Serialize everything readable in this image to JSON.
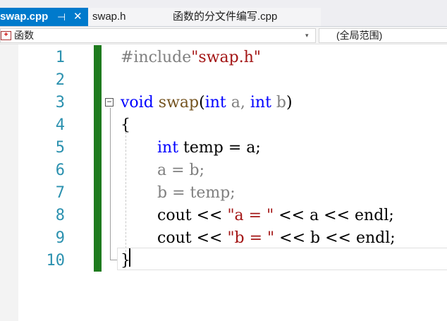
{
  "tabs": [
    {
      "label": "swap.cpp",
      "pin_glyph": "⊣",
      "close_glyph": "✕"
    },
    {
      "label": "swap.h"
    },
    {
      "label": "函数的分文件编写.cpp"
    }
  ],
  "navbar": {
    "scope_icon": "class-scope-icon",
    "scope_label": "函数",
    "scope_arrow": "▾",
    "member_label": "(全局范围)"
  },
  "editor": {
    "line_numbers": [
      "1",
      "2",
      "3",
      "4",
      "5",
      "6",
      "7",
      "8",
      "9",
      "10"
    ],
    "collapse_glyph": "−",
    "colors": {
      "keyword": "#0000ff",
      "string": "#a31515",
      "line_number": "#2b91af",
      "change_bar": "#1e7b1e",
      "tab_active_bg": "#007acc"
    },
    "code": {
      "l1": {
        "directive": "#include",
        "header": "\"swap.h\""
      },
      "l3": {
        "kw_void": "void",
        "fn": "swap",
        "open": "(",
        "kw_int1": "int",
        "param1": "a,",
        "kw_int2": "int",
        "param2": "b",
        "close": ")"
      },
      "l4": {
        "brace": "{"
      },
      "l5": {
        "kw_int": "int",
        "rest": "temp = a;"
      },
      "l6": {
        "text": "a = b;"
      },
      "l7": {
        "text": "b = temp;"
      },
      "l8": {
        "pre": "cout << ",
        "str": "\"a = \"",
        "post": " << a << endl;"
      },
      "l9": {
        "pre": "cout << ",
        "str": "\"b = \"",
        "post": " << b << endl;"
      },
      "l10": {
        "brace": "}"
      }
    }
  }
}
